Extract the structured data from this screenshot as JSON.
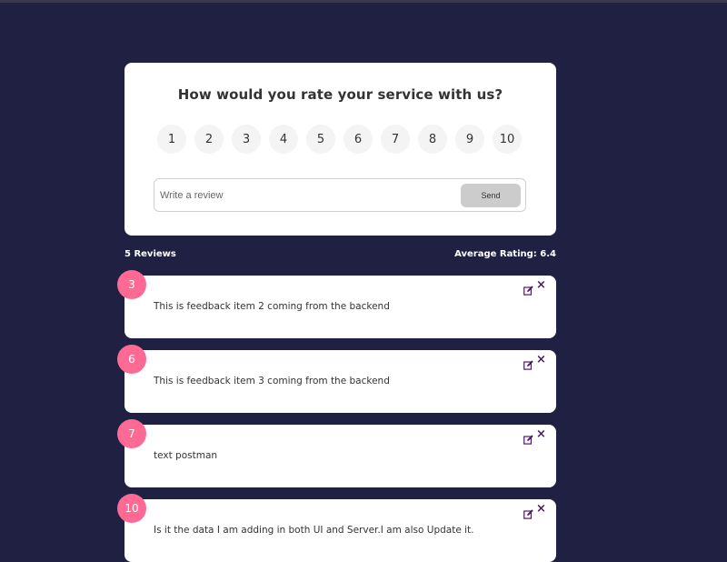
{
  "rating_card": {
    "title": "How would you rate your service with us?",
    "options": [
      "1",
      "2",
      "3",
      "4",
      "5",
      "6",
      "7",
      "8",
      "9",
      "10"
    ],
    "review_placeholder": "Write a review",
    "review_value": "",
    "send_label": "Send"
  },
  "stats": {
    "reviews_count": "5 Reviews",
    "average_rating": "Average Rating: 6.4"
  },
  "feedback": [
    {
      "rating": "3",
      "text": "This is feedback item 2 coming from the backend"
    },
    {
      "rating": "6",
      "text": "This is feedback item 3 coming from the backend"
    },
    {
      "rating": "7",
      "text": "text postman"
    },
    {
      "rating": "10",
      "text": "Is it the data I am adding in both UI and Server.I am also Update it."
    }
  ],
  "colors": {
    "background": "#202142",
    "badge": "#ff6a95",
    "icon": "#4a1a5f",
    "send_button": "#cccccc"
  },
  "icons": {
    "edit": "edit-icon",
    "delete": "close-icon"
  }
}
